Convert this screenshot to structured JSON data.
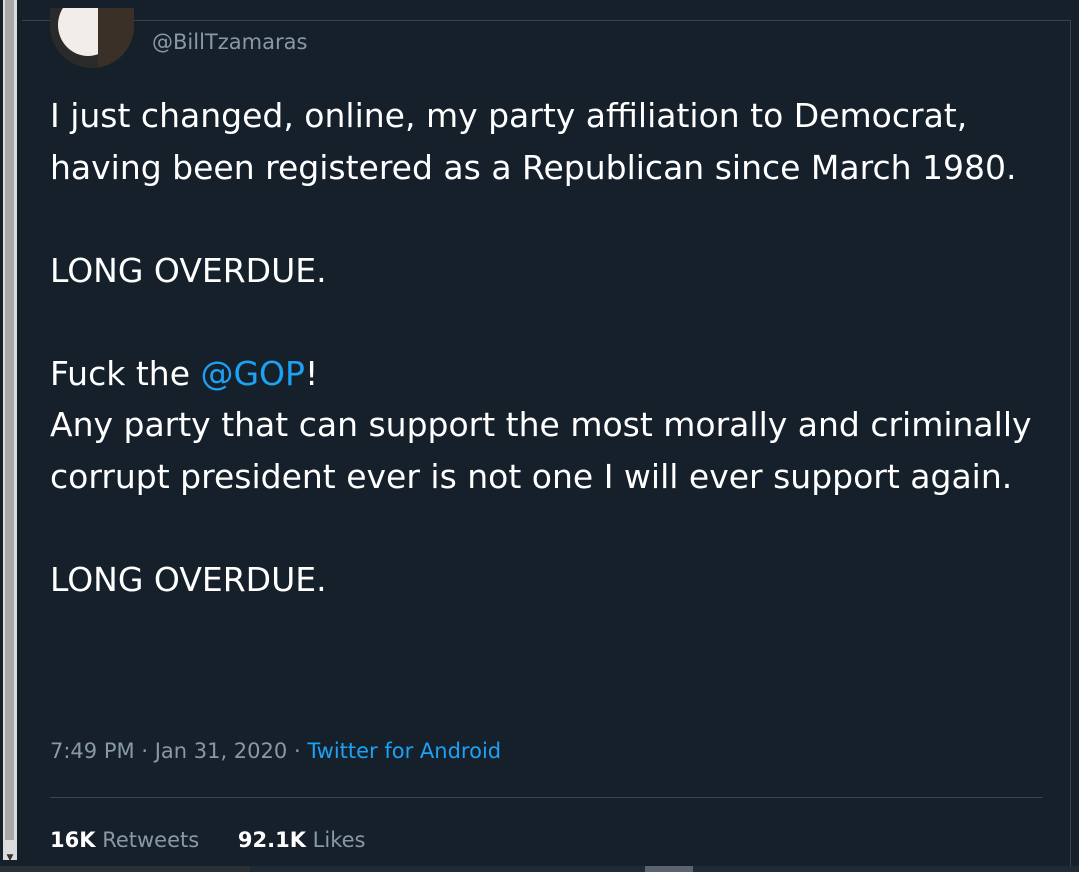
{
  "tweet": {
    "handle": "@BillTzamaras",
    "paragraphs": {
      "p1": "I just changed, online, my party affiliation to Democrat, having been registered as a Republican since March 1980.",
      "p2": "LONG OVERDUE.",
      "p3_prefix": "Fuck the ",
      "p3_mention": "@GOP",
      "p3_suffix": "!",
      "p4": "Any party that can support the most morally and criminally corrupt president ever is not one I will ever support again.",
      "p5": "LONG OVERDUE."
    },
    "time": "7:49 PM",
    "separator": "·",
    "date": "Jan 31, 2020",
    "source": "Twitter for Android",
    "retweets_count": "16K",
    "retweets_label": "Retweets",
    "likes_count": "92.1K",
    "likes_label": "Likes"
  },
  "colors": {
    "background": "#15202b",
    "text": "#ffffff",
    "secondary": "#8899a6",
    "link": "#1da1f2",
    "divider": "#38444d"
  },
  "icons": {
    "scroll_down": "chevron-down-icon"
  }
}
